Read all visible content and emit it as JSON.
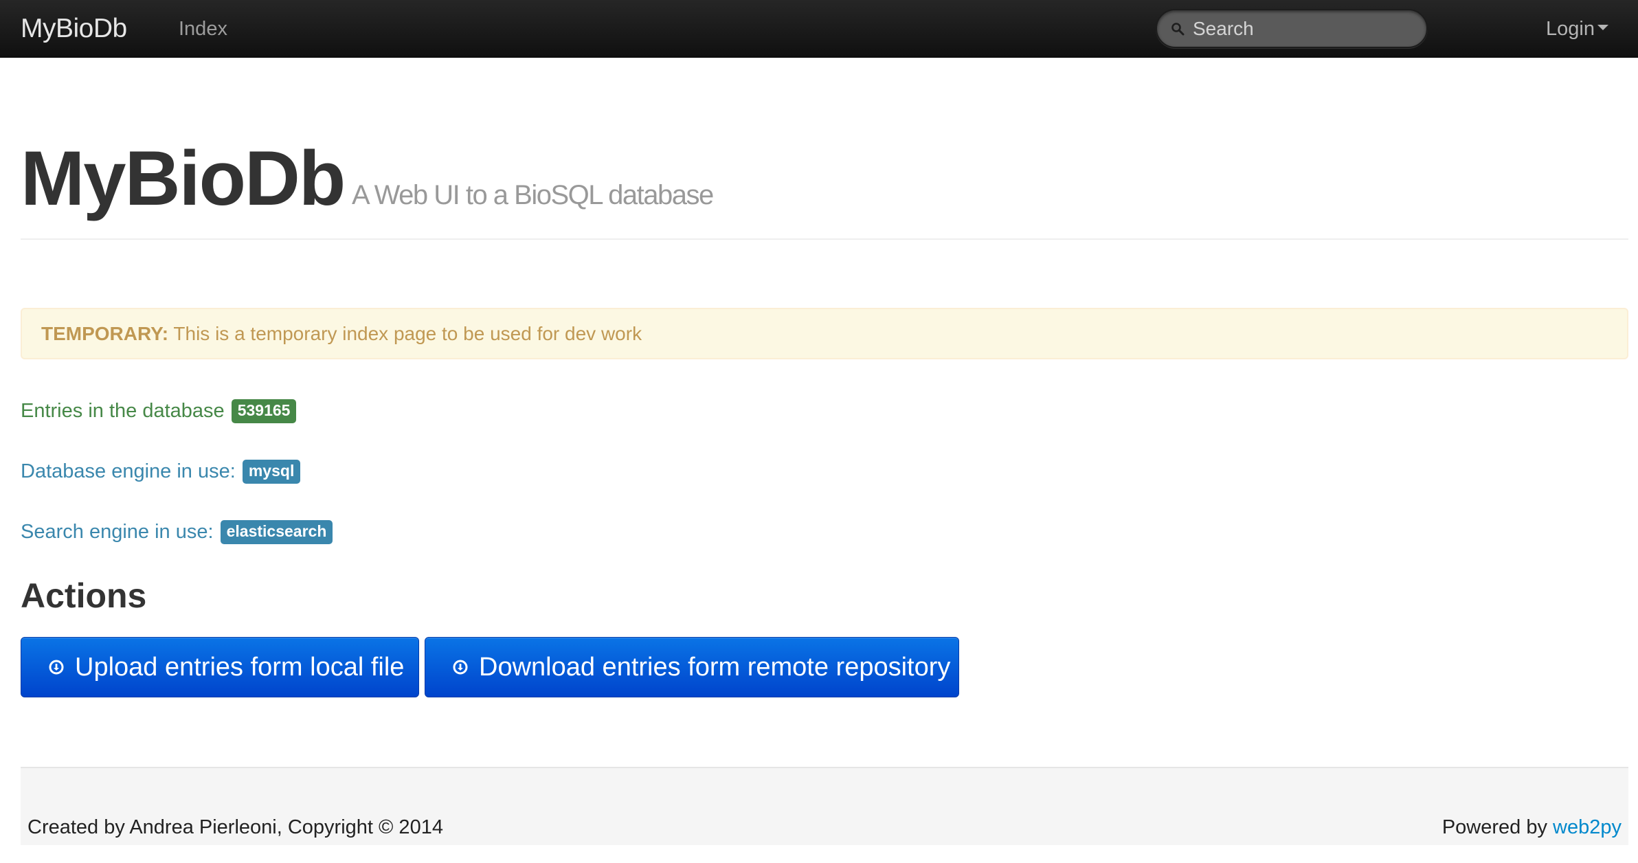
{
  "navbar": {
    "brand": "MyBioDb",
    "nav_index": "Index",
    "search_placeholder": "Search",
    "login_label": "Login",
    "search_icon": "search-icon",
    "login_icon": "caret-down-icon"
  },
  "header": {
    "title": "MyBioDb",
    "subtitle": "A Web UI to a BioSQL database"
  },
  "alert": {
    "strong": "TEMPORARY:",
    "text": "This is a temporary index page to be used for dev work"
  },
  "info": {
    "entries_label": "Entries in the database",
    "entries_count": "539165",
    "db_engine_label": "Database engine in use:",
    "db_engine_value": "mysql",
    "search_engine_label": "Search engine in use:",
    "search_engine_value": "elasticsearch"
  },
  "actions": {
    "title": "Actions",
    "upload_label": "Upload entries form local file",
    "download_label": "Download entries form remote repository",
    "button_icon": "circle-arrow-down-icon"
  },
  "footer": {
    "left": "Created by Andrea Pierleoni, Copyright © 2014",
    "powered_by": "Powered by",
    "link": "web2py"
  },
  "colors": {
    "navbar_bg": "#1b1b1b",
    "alert_bg": "#fcf8e3",
    "alert_text": "#c09853",
    "success": "#468847",
    "info": "#3a87ad",
    "primary_button": "#0044cc",
    "link": "#0088cc"
  }
}
